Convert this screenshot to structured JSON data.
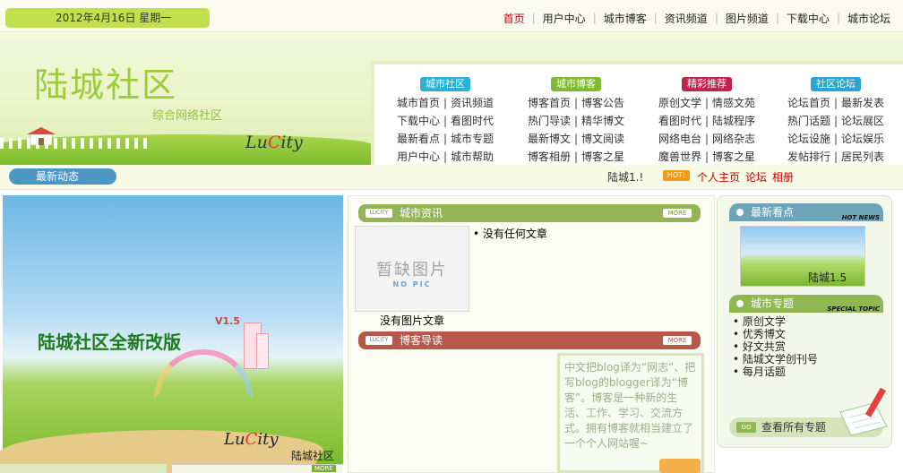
{
  "top": {
    "date": "2012年4月16日 星期一",
    "nav": [
      "首页",
      "用户中心",
      "城市博客",
      "资讯频道",
      "图片频道",
      "下载中心",
      "城市论坛"
    ],
    "active_index": 0
  },
  "banner": {
    "title": "陆城社区",
    "subtitle": "综合网络社区",
    "logo_text": [
      "Lu",
      "C",
      "ity"
    ],
    "menus": [
      {
        "tag": "城市社区",
        "color": "#2bb0d6",
        "rows": [
          [
            "城市首页",
            "资讯频道"
          ],
          [
            "下载中心",
            "看图时代"
          ],
          [
            "最新看点",
            "城市专题"
          ],
          [
            "用户中心",
            "城市帮助"
          ]
        ]
      },
      {
        "tag": "城市博客",
        "color": "#7fbb2e",
        "rows": [
          [
            "博客首页",
            "博客公告"
          ],
          [
            "热门导读",
            "精华博文"
          ],
          [
            "最新博文",
            "博文阅读"
          ],
          [
            "博客相册",
            "博客之星"
          ]
        ]
      },
      {
        "tag": "精彩推荐",
        "color": "#c0244a",
        "rows": [
          [
            "原创文学",
            "情感文苑"
          ],
          [
            "看图时代",
            "陆城程序"
          ],
          [
            "网络电台",
            "网络杂志"
          ],
          [
            "魔兽世界",
            "博客之星"
          ]
        ]
      },
      {
        "tag": "社区论坛",
        "color": "#2aa5cf",
        "rows": [
          [
            "论坛首页",
            "最新发表"
          ],
          [
            "热门话题",
            "论坛展区"
          ],
          [
            "论坛设施",
            "论坛娱乐"
          ],
          [
            "发帖排行",
            "居民列表"
          ]
        ]
      }
    ]
  },
  "news": {
    "label": "最新动态",
    "ticker": "陆城1.!",
    "hot": "HOT!",
    "links": [
      "个人主页",
      "论坛",
      "相册"
    ]
  },
  "hero": {
    "title": "陆城社区全新改版",
    "version": "V1.5",
    "logo_text": [
      "Lu",
      "C",
      "ity"
    ],
    "caption": "陆城社区",
    "more_mini": "MORE"
  },
  "city_news": {
    "mini_logo": "LUCITY",
    "title": "城市资讯",
    "more": "MORE",
    "no_image_cn": "暂缺图片",
    "no_image_en": "NO PIC",
    "empty_text": "没有任何文章",
    "no_image_article": "没有图片文章"
  },
  "blog_guide": {
    "mini_logo": "LUCITY",
    "title": "博客导读",
    "more": "MORE",
    "text": "中文把blog译为“网志”、把写blog的blogger译为“博客”。博客是一种新的生活、工作、学习、交流方式。拥有博客就相当建立了一个个人网站喔~"
  },
  "latest": {
    "title": "最新看点",
    "tag": "HOT NEWS",
    "caption": "陆城1.5"
  },
  "topics": {
    "title": "城市专题",
    "tag": "SPECIAL TOPIC",
    "items": [
      "原创文学",
      "优秀博文",
      "好文共赏",
      "陆城文学创刊号",
      "每月话题"
    ],
    "go": "GO",
    "all": "查看所有专题"
  }
}
